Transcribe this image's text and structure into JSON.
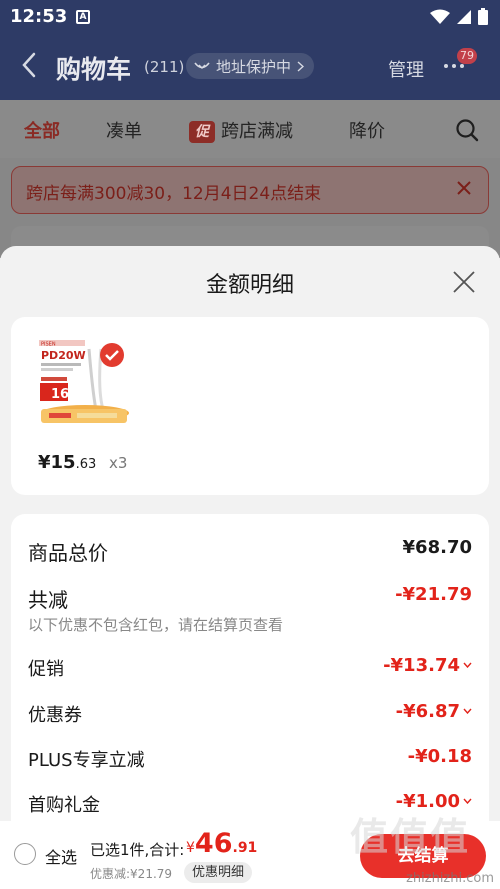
{
  "status_bar": {
    "time": "12:53",
    "notification_icon": "A"
  },
  "header": {
    "title": "购物车",
    "count": "(211)",
    "address_protect": "地址保护中",
    "manage": "管理",
    "badge": "79"
  },
  "tabs": [
    {
      "label": "全部",
      "active": true
    },
    {
      "label": "凑单",
      "active": false
    },
    {
      "label": "跨店满减",
      "active": false,
      "tag": "促"
    },
    {
      "label": "降价",
      "active": false
    }
  ],
  "promo": {
    "text": "跨店每满300减30，12月4日24点结束"
  },
  "sheet": {
    "title": "金额明细",
    "product": {
      "price_main": "¥15",
      "price_decimal": ".63",
      "quantity": "x3",
      "thumb_texts": {
        "brand": "PISEN",
        "model": "PD20W",
        "badge": "16"
      }
    },
    "total_label": "商品总价",
    "total_value": "¥68.70",
    "reduce_label": "共减",
    "reduce_value": "-¥21.79",
    "reduce_note": "以下优惠不包含红包，请在结算页查看",
    "items": [
      {
        "label": "促销",
        "value": "-¥13.74",
        "expandable": true
      },
      {
        "label": "优惠券",
        "value": "-¥6.87",
        "expandable": true
      },
      {
        "label": "PLUS专享立减",
        "value": "-¥0.18",
        "expandable": false
      },
      {
        "label": "首购礼金",
        "value": "-¥1.00",
        "expandable": true
      }
    ]
  },
  "bottom_bar": {
    "select_all": "全选",
    "summary": "已选1件,合计:",
    "total_yen": "¥",
    "total_int": "46",
    "total_dec": ".91",
    "discount": "优惠减:¥21.79",
    "detail_button": "优惠明细",
    "checkout": "去结算"
  },
  "watermark": "zhizhizhi.com",
  "colors": {
    "accent_red": "#e2231a",
    "header_navy": "#2e3b66",
    "checkout_red": "#e8302a"
  }
}
